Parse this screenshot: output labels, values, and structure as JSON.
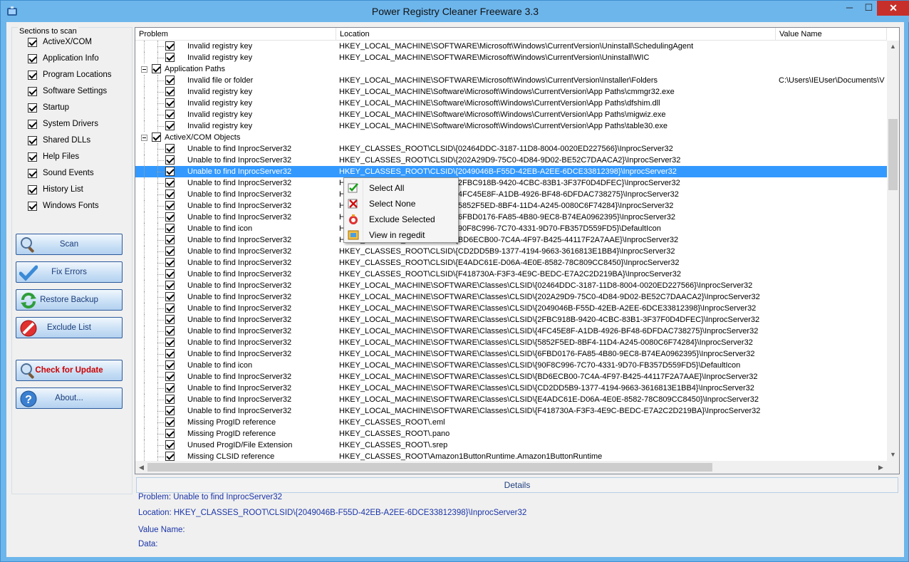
{
  "window": {
    "title": "Power Registry Cleaner Freeware 3.3",
    "minimize": "─",
    "maximize": "☐",
    "close": "✕"
  },
  "sections": {
    "label": "Sections to scan",
    "items": [
      {
        "label": "ActiveX/COM",
        "checked": true
      },
      {
        "label": "Application Info",
        "checked": true
      },
      {
        "label": "Program Locations",
        "checked": true
      },
      {
        "label": "Software Settings",
        "checked": true
      },
      {
        "label": "Startup",
        "checked": true
      },
      {
        "label": "System Drivers",
        "checked": true
      },
      {
        "label": "Shared DLLs",
        "checked": true
      },
      {
        "label": "Help Files",
        "checked": true
      },
      {
        "label": "Sound Events",
        "checked": true
      },
      {
        "label": "History List",
        "checked": true
      },
      {
        "label": "Windows Fonts",
        "checked": true
      }
    ]
  },
  "buttons": {
    "scan": "Scan",
    "fix": "Fix Errors",
    "restore": "Restore Backup",
    "exclude": "Exclude List",
    "update": "Check for Update",
    "about": "About..."
  },
  "columns": {
    "problem": "Problem",
    "location": "Location",
    "value": "Value Name"
  },
  "rows": [
    {
      "type": "item",
      "problem": "Invalid registry key",
      "location": "HKEY_LOCAL_MACHINE\\SOFTWARE\\Microsoft\\Windows\\CurrentVersion\\Uninstall\\SchedulingAgent",
      "value": ""
    },
    {
      "type": "item",
      "problem": "Invalid registry key",
      "location": "HKEY_LOCAL_MACHINE\\SOFTWARE\\Microsoft\\Windows\\CurrentVersion\\Uninstall\\WIC",
      "value": ""
    },
    {
      "type": "group",
      "problem": "Application Paths",
      "location": "",
      "value": ""
    },
    {
      "type": "item",
      "problem": "Invalid file or folder",
      "location": "HKEY_LOCAL_MACHINE\\SOFTWARE\\Microsoft\\Windows\\CurrentVersion\\Installer\\Folders",
      "value": "C:\\Users\\IEUser\\Documents\\V"
    },
    {
      "type": "item",
      "problem": "Invalid registry key",
      "location": "HKEY_LOCAL_MACHINE\\Software\\Microsoft\\Windows\\CurrentVersion\\App  Paths\\cmmgr32.exe",
      "value": ""
    },
    {
      "type": "item",
      "problem": "Invalid registry key",
      "location": "HKEY_LOCAL_MACHINE\\Software\\Microsoft\\Windows\\CurrentVersion\\App  Paths\\dfshim.dll",
      "value": ""
    },
    {
      "type": "item",
      "problem": "Invalid registry key",
      "location": "HKEY_LOCAL_MACHINE\\Software\\Microsoft\\Windows\\CurrentVersion\\App  Paths\\migwiz.exe",
      "value": ""
    },
    {
      "type": "item",
      "problem": "Invalid registry key",
      "location": "HKEY_LOCAL_MACHINE\\Software\\Microsoft\\Windows\\CurrentVersion\\App  Paths\\table30.exe",
      "value": ""
    },
    {
      "type": "group",
      "problem": "ActiveX/COM Objects",
      "location": "",
      "value": ""
    },
    {
      "type": "item",
      "problem": "Unable to find InprocServer32",
      "location": "HKEY_CLASSES_ROOT\\CLSID\\{02464DDC-3187-11D8-8004-0020ED227566}\\InprocServer32",
      "value": ""
    },
    {
      "type": "item",
      "problem": "Unable to find InprocServer32",
      "location": "HKEY_CLASSES_ROOT\\CLSID\\{202A29D9-75C0-4D84-9D02-BE52C7DAACA2}\\InprocServer32",
      "value": ""
    },
    {
      "type": "item",
      "selected": true,
      "problem": "Unable to find InprocServer32",
      "location": "HKEY_CLASSES_ROOT\\CLSID\\{2049046B-F55D-42EB-A2EE-6DCE33812398}\\InprocServer32",
      "value": ""
    },
    {
      "type": "item",
      "problem": "Unable to find InprocServer32",
      "location": "HKEY_CLASSES_ROOT\\CLSID\\{2FBC918B-9420-4CBC-83B1-3F37F0D4DFEC}\\InprocServer32",
      "value": ""
    },
    {
      "type": "item",
      "problem": "Unable to find InprocServer32",
      "location": "HKEY_CLASSES_ROOT\\CLSID\\{4FC45E8F-A1DB-4926-BF48-6DFDAC738275}\\InprocServer32",
      "value": ""
    },
    {
      "type": "item",
      "problem": "Unable to find InprocServer32",
      "location": "HKEY_CLASSES_ROOT\\CLSID\\{5852F5ED-8BF4-11D4-A245-0080C6F74284}\\InprocServer32",
      "value": ""
    },
    {
      "type": "item",
      "problem": "Unable to find InprocServer32",
      "location": "HKEY_CLASSES_ROOT\\CLSID\\{6FBD0176-FA85-4B80-9EC8-B74EA0962395}\\InprocServer32",
      "value": ""
    },
    {
      "type": "item",
      "problem": "Unable to find icon",
      "location": "HKEY_CLASSES_ROOT\\CLSID\\{90F8C996-7C70-4331-9D70-FB357D559FD5}\\DefaultIcon",
      "value": ""
    },
    {
      "type": "item",
      "problem": "Unable to find InprocServer32",
      "location": "HKEY_CLASSES_ROOT\\CLSID\\{BD6ECB00-7C4A-4F97-B425-44117F2A7AAE}\\InprocServer32",
      "value": ""
    },
    {
      "type": "item",
      "problem": "Unable to find InprocServer32",
      "location": "HKEY_CLASSES_ROOT\\CLSID\\{CD2DD5B9-1377-4194-9663-3616813E1BB4}\\InprocServer32",
      "value": ""
    },
    {
      "type": "item",
      "problem": "Unable to find InprocServer32",
      "location": "HKEY_CLASSES_ROOT\\CLSID\\{E4ADC61E-D06A-4E0E-8582-78C809CC8450}\\InprocServer32",
      "value": ""
    },
    {
      "type": "item",
      "problem": "Unable to find InprocServer32",
      "location": "HKEY_CLASSES_ROOT\\CLSID\\{F418730A-F3F3-4E9C-BEDC-E7A2C2D219BA}\\InprocServer32",
      "value": ""
    },
    {
      "type": "item",
      "problem": "Unable to find InprocServer32",
      "location": "HKEY_LOCAL_MACHINE\\SOFTWARE\\Classes\\CLSID\\{02464DDC-3187-11D8-8004-0020ED227566}\\InprocServer32",
      "value": ""
    },
    {
      "type": "item",
      "problem": "Unable to find InprocServer32",
      "location": "HKEY_LOCAL_MACHINE\\SOFTWARE\\Classes\\CLSID\\{202A29D9-75C0-4D84-9D02-BE52C7DAACA2}\\InprocServer32",
      "value": ""
    },
    {
      "type": "item",
      "problem": "Unable to find InprocServer32",
      "location": "HKEY_LOCAL_MACHINE\\SOFTWARE\\Classes\\CLSID\\{2049046B-F55D-42EB-A2EE-6DCE33812398}\\InprocServer32",
      "value": ""
    },
    {
      "type": "item",
      "problem": "Unable to find InprocServer32",
      "location": "HKEY_LOCAL_MACHINE\\SOFTWARE\\Classes\\CLSID\\{2FBC918B-9420-4CBC-83B1-3F37F0D4DFEC}\\InprocServer32",
      "value": ""
    },
    {
      "type": "item",
      "problem": "Unable to find InprocServer32",
      "location": "HKEY_LOCAL_MACHINE\\SOFTWARE\\Classes\\CLSID\\{4FC45E8F-A1DB-4926-BF48-6DFDAC738275}\\InprocServer32",
      "value": ""
    },
    {
      "type": "item",
      "problem": "Unable to find InprocServer32",
      "location": "HKEY_LOCAL_MACHINE\\SOFTWARE\\Classes\\CLSID\\{5852F5ED-8BF4-11D4-A245-0080C6F74284}\\InprocServer32",
      "value": ""
    },
    {
      "type": "item",
      "problem": "Unable to find InprocServer32",
      "location": "HKEY_LOCAL_MACHINE\\SOFTWARE\\Classes\\CLSID\\{6FBD0176-FA85-4B80-9EC8-B74EA0962395}\\InprocServer32",
      "value": ""
    },
    {
      "type": "item",
      "problem": "Unable to find icon",
      "location": "HKEY_LOCAL_MACHINE\\SOFTWARE\\Classes\\CLSID\\{90F8C996-7C70-4331-9D70-FB357D559FD5}\\DefaultIcon",
      "value": ""
    },
    {
      "type": "item",
      "problem": "Unable to find InprocServer32",
      "location": "HKEY_LOCAL_MACHINE\\SOFTWARE\\Classes\\CLSID\\{BD6ECB00-7C4A-4F97-B425-44117F2A7AAE}\\InprocServer32",
      "value": ""
    },
    {
      "type": "item",
      "problem": "Unable to find InprocServer32",
      "location": "HKEY_LOCAL_MACHINE\\SOFTWARE\\Classes\\CLSID\\{CD2DD5B9-1377-4194-9663-3616813E1BB4}\\InprocServer32",
      "value": ""
    },
    {
      "type": "item",
      "problem": "Unable to find InprocServer32",
      "location": "HKEY_LOCAL_MACHINE\\SOFTWARE\\Classes\\CLSID\\{E4ADC61E-D06A-4E0E-8582-78C809CC8450}\\InprocServer32",
      "value": ""
    },
    {
      "type": "item",
      "problem": "Unable to find InprocServer32",
      "location": "HKEY_LOCAL_MACHINE\\SOFTWARE\\Classes\\CLSID\\{F418730A-F3F3-4E9C-BEDC-E7A2C2D219BA}\\InprocServer32",
      "value": ""
    },
    {
      "type": "item",
      "problem": "Missing ProgID reference",
      "location": "HKEY_CLASSES_ROOT\\.eml",
      "value": ""
    },
    {
      "type": "item",
      "problem": "Missing ProgID reference",
      "location": "HKEY_CLASSES_ROOT\\.pano",
      "value": ""
    },
    {
      "type": "item",
      "problem": "Unused ProgID/File Extension",
      "location": "HKEY_CLASSES_ROOT\\.srep",
      "value": ""
    },
    {
      "type": "item",
      "problem": "Missing CLSID reference",
      "location": "HKEY_CLASSES_ROOT\\Amazon1ButtonRuntime.Amazon1ButtonRuntime",
      "value": ""
    }
  ],
  "context_menu": [
    {
      "label": "Select All",
      "icon": "check-icon"
    },
    {
      "label": "Select None",
      "icon": "red-x-icon"
    },
    {
      "label": "Exclude Selected",
      "icon": "no-entry-icon"
    },
    {
      "label": "View in regedit",
      "icon": "regedit-icon"
    }
  ],
  "details": {
    "header": "Details",
    "problem": "Problem: Unable to find InprocServer32",
    "location": "Location: HKEY_CLASSES_ROOT\\CLSID\\{2049046B-F55D-42EB-A2EE-6DCE33812398}\\InprocServer32",
    "value_name": "Value Name:",
    "data": "Data:"
  },
  "colors": {
    "selection": "#3399ff",
    "window_frame": "#6db6ec",
    "close_button": "#c7302a",
    "details_text": "#1a34a8",
    "update_text": "#cc0000"
  }
}
